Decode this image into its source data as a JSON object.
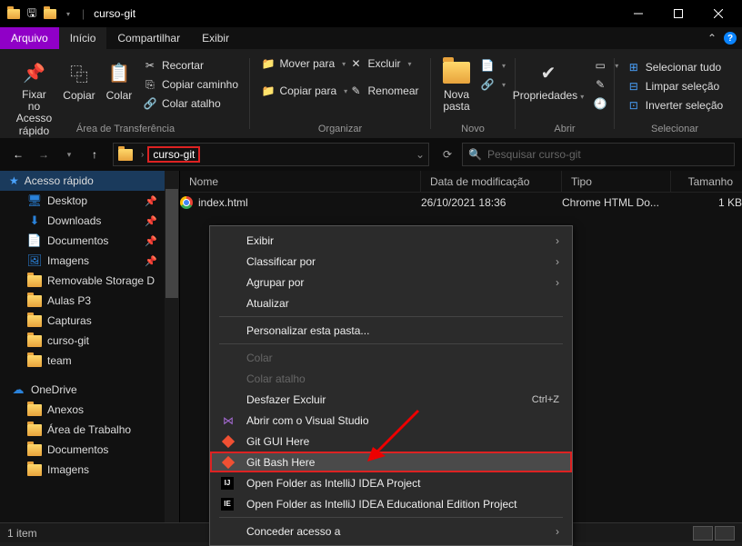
{
  "window": {
    "title": "curso-git"
  },
  "tabs": {
    "arquivo": "Arquivo",
    "inicio": "Início",
    "compartilhar": "Compartilhar",
    "exibir": "Exibir"
  },
  "ribbon": {
    "fixar": "Fixar no\nAcesso rápido",
    "copiar": "Copiar",
    "colar": "Colar",
    "recortar": "Recortar",
    "copiar_caminho": "Copiar caminho",
    "colar_atalho": "Colar atalho",
    "area": "Área de Transferência",
    "mover": "Mover para",
    "copiar_para": "Copiar para",
    "excluir": "Excluir",
    "renomear": "Renomear",
    "organizar": "Organizar",
    "nova_pasta": "Nova\npasta",
    "novo": "Novo",
    "propriedades": "Propriedades",
    "abrir": "Abrir",
    "sel_tudo": "Selecionar tudo",
    "limpar_sel": "Limpar seleção",
    "inverter_sel": "Inverter seleção",
    "selecionar": "Selecionar"
  },
  "breadcrumb": {
    "seg": "curso-git"
  },
  "search": {
    "placeholder": "Pesquisar curso-git"
  },
  "columns": {
    "nome": "Nome",
    "data": "Data de modificação",
    "tipo": "Tipo",
    "tamanho": "Tamanho"
  },
  "file": {
    "name": "index.html",
    "date": "26/10/2021 18:36",
    "type": "Chrome HTML Do...",
    "size": "1 KB"
  },
  "nav": {
    "acesso": "Acesso rápido",
    "desktop": "Desktop",
    "downloads": "Downloads",
    "documentos": "Documentos",
    "imagens": "Imagens",
    "removable": "Removable Storage D",
    "aulas": "Aulas P3",
    "capturas": "Capturas",
    "curso": "curso-git",
    "team": "team",
    "onedrive": "OneDrive",
    "anexos": "Anexos",
    "area_trabalho": "Área de Trabalho",
    "documentos2": "Documentos",
    "imagens2": "Imagens"
  },
  "ctx": {
    "exibir": "Exibir",
    "classificar": "Classificar por",
    "agrupar": "Agrupar por",
    "atualizar": "Atualizar",
    "personalizar": "Personalizar esta pasta...",
    "colar": "Colar",
    "colar_atalho": "Colar atalho",
    "desfazer": "Desfazer Excluir",
    "desfazer_sc": "Ctrl+Z",
    "vs": "Abrir com o Visual Studio",
    "git_gui": "Git GUI Here",
    "git_bash": "Git Bash Here",
    "intellij": "Open Folder as IntelliJ IDEA Project",
    "intellij_edu": "Open Folder as IntelliJ IDEA Educational Edition Project",
    "conceder": "Conceder acesso a"
  },
  "status": {
    "items": "1 item"
  }
}
